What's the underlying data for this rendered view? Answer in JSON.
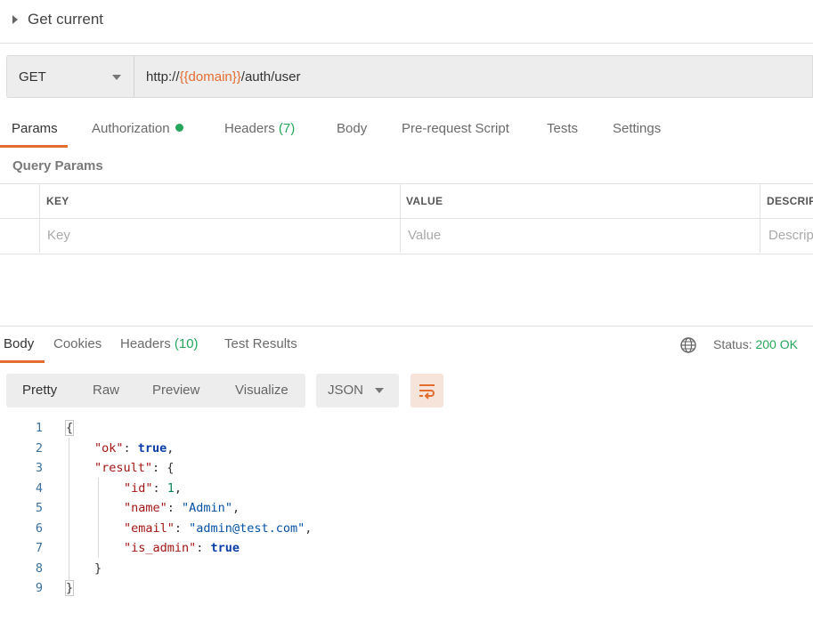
{
  "request": {
    "name": "Get current",
    "method": "GET",
    "url": {
      "prefix": "http://",
      "variable": "{{domain}}",
      "suffix": "/auth/user"
    }
  },
  "request_tabs": {
    "params": "Params",
    "authorization": "Authorization",
    "headers": "Headers",
    "headers_count": "(7)",
    "body": "Body",
    "prerequest": "Pre-request Script",
    "tests": "Tests",
    "settings": "Settings"
  },
  "query_params": {
    "title": "Query Params",
    "columns": [
      "KEY",
      "VALUE",
      "DESCRIPTION"
    ],
    "placeholders": [
      "Key",
      "Value",
      "Description"
    ]
  },
  "response_tabs": {
    "body": "Body",
    "cookies": "Cookies",
    "headers": "Headers",
    "headers_count": "(10)",
    "test_results": "Test Results"
  },
  "status": {
    "label": "Status:",
    "value": "200 OK"
  },
  "view_modes": {
    "pretty": "Pretty",
    "raw": "Raw",
    "preview": "Preview",
    "visualize": "Visualize"
  },
  "format": "JSON",
  "code": {
    "line_numbers": [
      "1",
      "2",
      "3",
      "4",
      "5",
      "6",
      "7",
      "8",
      "9"
    ],
    "open_brace": "{",
    "close_brace": "}",
    "ok_key": "\"ok\"",
    "ok_value": "true",
    "result_key": "\"result\"",
    "result_open": "{",
    "result_close": "}",
    "id_key": "\"id\"",
    "id_value": "1",
    "name_key": "\"name\"",
    "name_value": "\"Admin\"",
    "email_key": "\"email\"",
    "email_value": "\"admin@test.com\"",
    "is_admin_key": "\"is_admin\"",
    "is_admin_value": "true"
  },
  "colors": {
    "accent": "#e46c2f",
    "success": "#26a65b"
  }
}
